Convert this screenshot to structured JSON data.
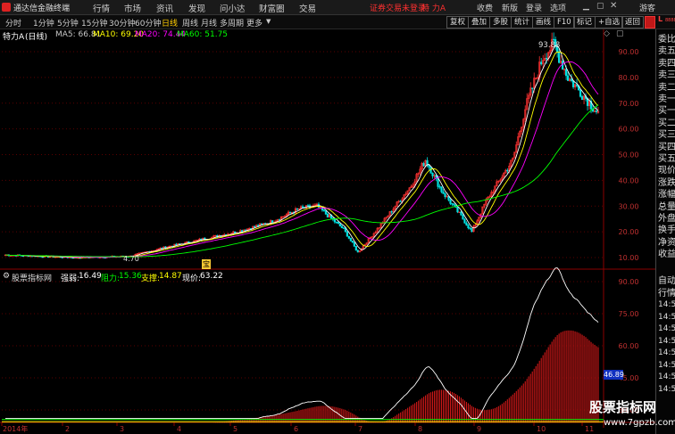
{
  "menu": {
    "app_title": "通达信金融终端",
    "items": [
      "行情",
      "市场",
      "资讯",
      "发现",
      "问小达",
      "财富圈",
      "交易"
    ],
    "notice": "证券交易未登录",
    "stock_link": "特 力A",
    "right_items": [
      "收费",
      "新版",
      "登录",
      "选项"
    ],
    "guest": "游客"
  },
  "periods": {
    "items": [
      "分时",
      "1分钟",
      "5分钟",
      "15分钟",
      "30分钟",
      "60分钟",
      "日线",
      "周线",
      "月线",
      "多周期",
      "更多"
    ],
    "active": "日线"
  },
  "toolbar": {
    "buttons": [
      "复权",
      "叠加",
      "多股",
      "统计",
      "画线",
      "F10",
      "标记",
      "+自选",
      "返回"
    ]
  },
  "main_chart": {
    "stock": "特力A",
    "period_label": "(日线)",
    "ma": [
      {
        "label": "MA5: 66.81",
        "color": "#ffffff"
      },
      {
        "label": "MA10: 69.20",
        "color": "#ffff00"
      },
      {
        "label": "MA20: 74.44",
        "color": "#ff00ff"
      },
      {
        "label": "MA60: 51.75",
        "color": "#00ff00"
      }
    ],
    "price_axis": [
      "90.00",
      "80.00",
      "70.00",
      "60.00",
      "50.00",
      "40.00",
      "30.00",
      "20.00",
      "10.00"
    ],
    "high_label": "93.88",
    "low_label": "4.70",
    "event_marker": "宝"
  },
  "sub_chart": {
    "title": "股票指标网",
    "metrics": [
      {
        "label": "强弱:",
        "value": "16.49",
        "color": "#ffffff"
      },
      {
        "label": "阻力:",
        "value": "15.36",
        "color": "#00ff00"
      },
      {
        "label": "支撑:",
        "value": "14.87",
        "color": "#ffff00"
      },
      {
        "label": "现价:",
        "value": "63.22",
        "color": "#ffffff"
      }
    ],
    "axis": [
      "90.00",
      "75.00",
      "60.00",
      "45.00",
      "30.00"
    ],
    "current_badge": "46.89"
  },
  "xaxis": {
    "labels": [
      "2014年",
      "2",
      "3",
      "4",
      "5",
      "6",
      "7",
      "8",
      "9",
      "10",
      "11"
    ]
  },
  "right_panel": {
    "labels": [
      "委比",
      "卖五",
      "卖四",
      "卖三",
      "卖二",
      "卖一",
      "买一",
      "买二",
      "买三",
      "买四",
      "买五",
      "现价",
      "涨跌",
      "涨幅",
      "总量",
      "外盘",
      "换手",
      "净资",
      "收益"
    ],
    "header_badge": "L",
    "header_small": "8888",
    "auto_label": "自动",
    "quote_label": "行情",
    "times": [
      "14:56",
      "14:56",
      "14:56",
      "14:56",
      "14:56",
      "14:56",
      "14:56",
      "14:56"
    ]
  },
  "watermark": {
    "title": "股票指标网",
    "url": "www.7gpzb.com"
  }
}
